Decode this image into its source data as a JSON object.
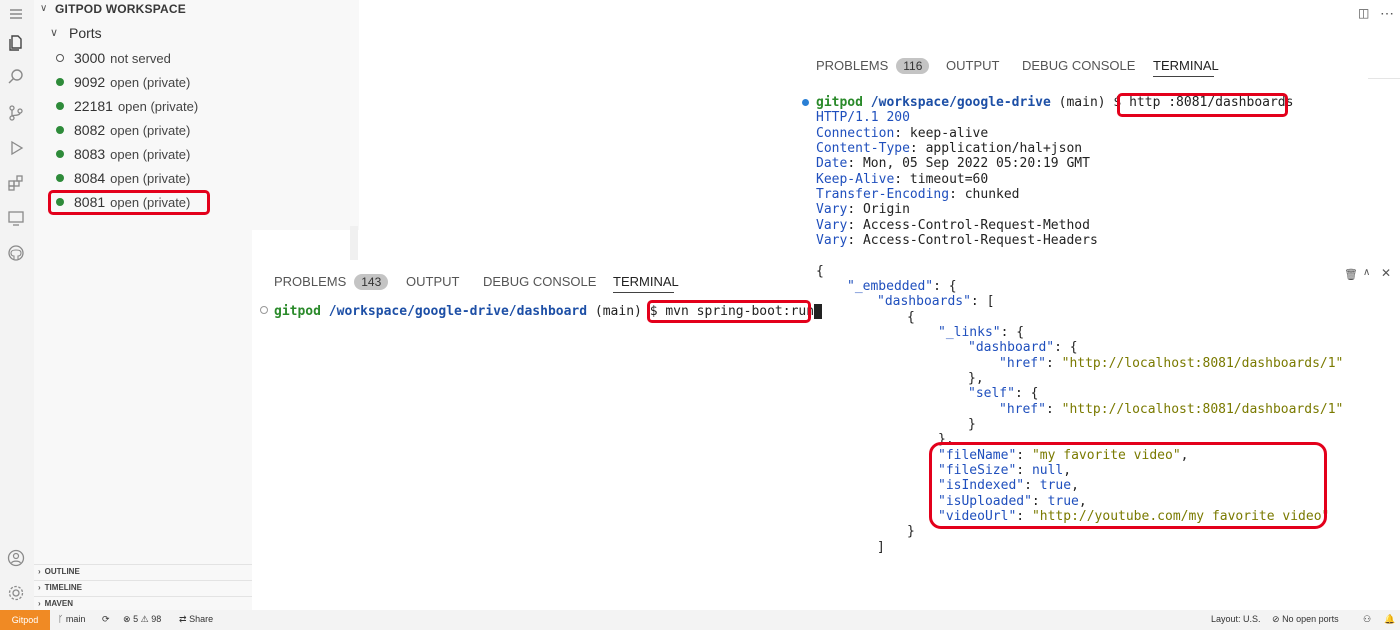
{
  "sidebar": {
    "title": "GITPOD WORKSPACE",
    "ports_label": "Ports",
    "ports": [
      {
        "number": "3000",
        "status": "not served"
      },
      {
        "number": "9092",
        "status": "open (private)"
      },
      {
        "number": "22181",
        "status": "open (private)"
      },
      {
        "number": "8082",
        "status": "open (private)"
      },
      {
        "number": "8083",
        "status": "open (private)"
      },
      {
        "number": "8084",
        "status": "open (private)"
      },
      {
        "number": "8081",
        "status": "open (private)"
      }
    ],
    "sections": [
      "OUTLINE",
      "TIMELINE",
      "MAVEN"
    ]
  },
  "panel_left": {
    "tabs": [
      "PROBLEMS",
      "OUTPUT",
      "DEBUG CONSOLE",
      "TERMINAL"
    ],
    "problems_count": "143",
    "prompt_user": "gitpod",
    "prompt_path": "/workspace/google-drive/dashboard",
    "prompt_branch": "(main) $",
    "command": "mvn spring-boot:run"
  },
  "panel_right": {
    "tabs": [
      "PROBLEMS",
      "OUTPUT",
      "DEBUG CONSOLE",
      "TERMINAL"
    ],
    "problems_count": "116",
    "prompt_user": "gitpod",
    "prompt_path": "/workspace/google-drive",
    "prompt_branch": "(main) $",
    "command": "http :8081/dashboards",
    "headers": [
      {
        "k": "HTTP/1.1",
        "v": " 200"
      },
      {
        "k": "Connection",
        "v": ": keep-alive"
      },
      {
        "k": "Content-Type",
        "v": ": application/hal+json"
      },
      {
        "k": "Date",
        "v": ": Mon, 05 Sep 2022 05:20:19 GMT"
      },
      {
        "k": "Keep-Alive",
        "v": ": timeout=60"
      },
      {
        "k": "Transfer-Encoding",
        "v": ": chunked"
      },
      {
        "k": "Vary",
        "v": ": Origin"
      },
      {
        "k": "Vary",
        "v": ": Access-Control-Request-Method"
      },
      {
        "k": "Vary",
        "v": ": Access-Control-Request-Headers"
      }
    ],
    "json": {
      "open": "{",
      "embedded_key": "\"_embedded\"",
      "embedded_rest": ": {",
      "dashboards_key": "\"dashboards\"",
      "dashboards_rest": ": [",
      "item_open": "{",
      "links_key": "\"_links\"",
      "links_rest": ": {",
      "dashboard_key": "\"dashboard\"",
      "dashboard_rest": ": {",
      "href_key": "\"href\"",
      "href_val": "\"http://localhost:8081/dashboards/1\"",
      "close_comma": "},",
      "self_key": "\"self\"",
      "self_rest": ": {",
      "close": "}",
      "fields": [
        {
          "k": "\"fileName\"",
          "v": "\"my favorite video\"",
          "end": ",",
          "str": true
        },
        {
          "k": "\"fileSize\"",
          "v": "null",
          "end": ",",
          "str": false
        },
        {
          "k": "\"isIndexed\"",
          "v": "true",
          "end": ",",
          "str": false
        },
        {
          "k": "\"isUploaded\"",
          "v": "true",
          "end": ",",
          "str": false
        },
        {
          "k": "\"videoUrl\"",
          "v": "\"http://youtube.com/my favorite video\"",
          "end": "",
          "str": true
        }
      ],
      "item_close": "}",
      "array_close": "]"
    }
  },
  "status_bar": {
    "gitpod": "Gitpod",
    "branch": "main",
    "errors": "5",
    "warnings": "98",
    "share": "Share",
    "layout": "Layout: U.S.",
    "ports": "No open ports"
  }
}
